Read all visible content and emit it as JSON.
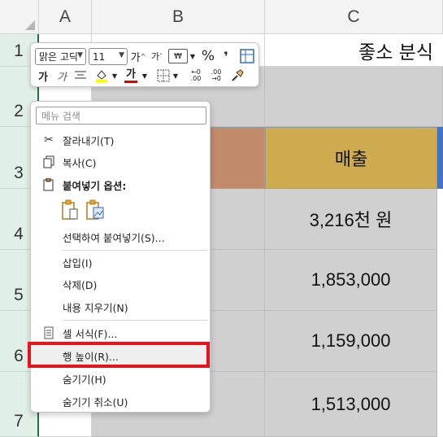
{
  "columns": [
    "A",
    "B",
    "C"
  ],
  "rows": [
    "1",
    "2",
    "3",
    "4",
    "5",
    "6",
    "7"
  ],
  "title_cell": "좋소 분식",
  "header_cell": "매출",
  "values": [
    "3,216천 원",
    "1,853,000",
    "1,159,000",
    "1,513,000"
  ],
  "mini_toolbar": {
    "font_name": "맑은 고딕",
    "font_size": "11",
    "grow_font": "가",
    "shrink_font": "가",
    "bold": "가",
    "italic": "가",
    "font_color_glyph": "가",
    "percent": "%",
    "comma": "❜",
    "highlight_color": "#ffff00",
    "font_color": "#e00000"
  },
  "menu": {
    "search_placeholder": "메뉴 검색",
    "items": [
      {
        "label": "잘라내기(T)",
        "icon": "scissors-icon"
      },
      {
        "label": "복사(C)",
        "icon": "copy-icon"
      },
      {
        "label": "붙여넣기 옵션:",
        "icon": "paste-icon"
      },
      {
        "label": "선택하여 붙여넣기(S)..."
      },
      {
        "label": "삽입(I)"
      },
      {
        "label": "삭제(D)"
      },
      {
        "label": "내용 지우기(N)"
      },
      {
        "label": "셀 서식(F)...",
        "icon": "format-cells-icon"
      },
      {
        "label": "행 높이(R)..."
      },
      {
        "label": "숨기기(H)"
      },
      {
        "label": "숨기기 취소(U)"
      }
    ]
  },
  "colors": {
    "header_gold": "#cfab4f",
    "cell_brown": "#c28b6c",
    "cell_gray": "#d0d0d0",
    "highlight_border": "#e8141c",
    "row_header_selected": "#e1f0e6"
  }
}
